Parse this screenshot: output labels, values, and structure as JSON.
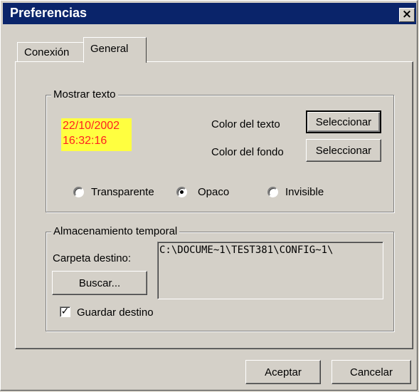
{
  "window": {
    "title": "Preferencias",
    "close_glyph": "×"
  },
  "tabs": [
    {
      "label": "Conexión",
      "active": false
    },
    {
      "label": "General",
      "active": true
    }
  ],
  "mostrar_texto": {
    "group_label": "Mostrar texto",
    "preview_date": "22/10/2002",
    "preview_time": "16:32:16",
    "preview_text_color": "#ff2020",
    "preview_bg_color": "#ffff40",
    "color_texto_label": "Color del texto",
    "color_fondo_label": "Color del fondo",
    "seleccionar_texto_button": "Seleccionar",
    "seleccionar_fondo_button": "Seleccionar",
    "options": [
      {
        "label": "Transparente",
        "selected": false
      },
      {
        "label": "Opaco",
        "selected": true
      },
      {
        "label": "Invisible",
        "selected": false
      }
    ]
  },
  "almacenamiento": {
    "group_label": "Almacenamiento temporal",
    "carpeta_label": "Carpeta destino:",
    "carpeta_value": "C:\\DOCUME~1\\TEST381\\CONFIG~1\\",
    "buscar_button": "Buscar...",
    "guardar_destino_label": "Guardar destino",
    "guardar_destino_checked": true,
    "check_glyph": "✓"
  },
  "footer": {
    "aceptar_button": "Aceptar",
    "cancelar_button": "Cancelar"
  }
}
